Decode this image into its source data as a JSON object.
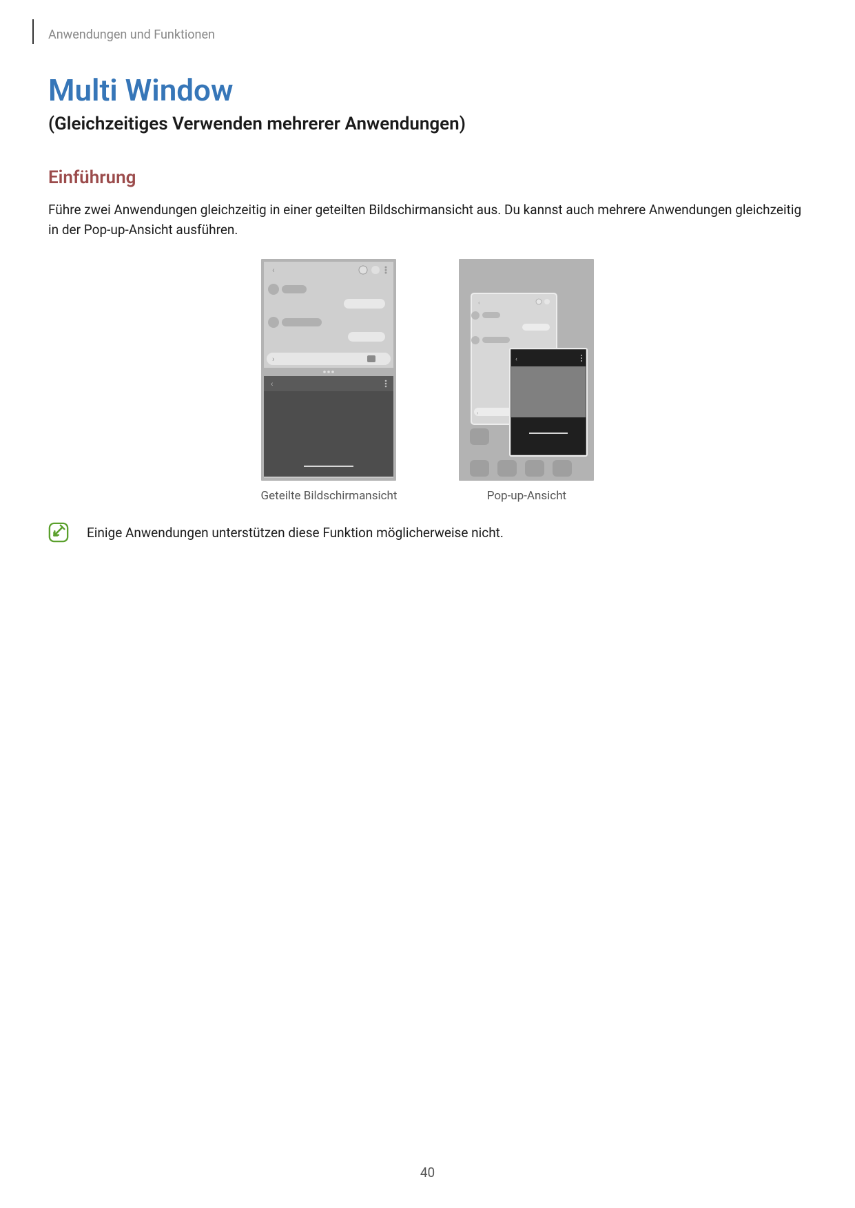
{
  "header": {
    "breadcrumb": "Anwendungen und Funktionen"
  },
  "title": "Multi Window",
  "subtitle": "(Gleichzeitiges Verwenden mehrerer Anwendungen)",
  "section": {
    "heading": "Einführung",
    "paragraph": "Führe zwei Anwendungen gleichzeitig in einer geteilten Bildschirmansicht aus. Du kannst auch mehrere Anwendungen gleichzeitig in der Pop-up-Ansicht ausführen."
  },
  "figures": {
    "left_caption": "Geteilte Bildschirmansicht",
    "right_caption": "Pop-up-Ansicht"
  },
  "note": {
    "text": "Einige Anwendungen unterstützen diese Funktion möglicherweise nicht.",
    "icon": "note-icon"
  },
  "page_number": "40",
  "colors": {
    "title_blue": "#3676b8",
    "section_maroon": "#9b4b4b",
    "grey_text": "#888",
    "note_green": "#5aa02c"
  }
}
